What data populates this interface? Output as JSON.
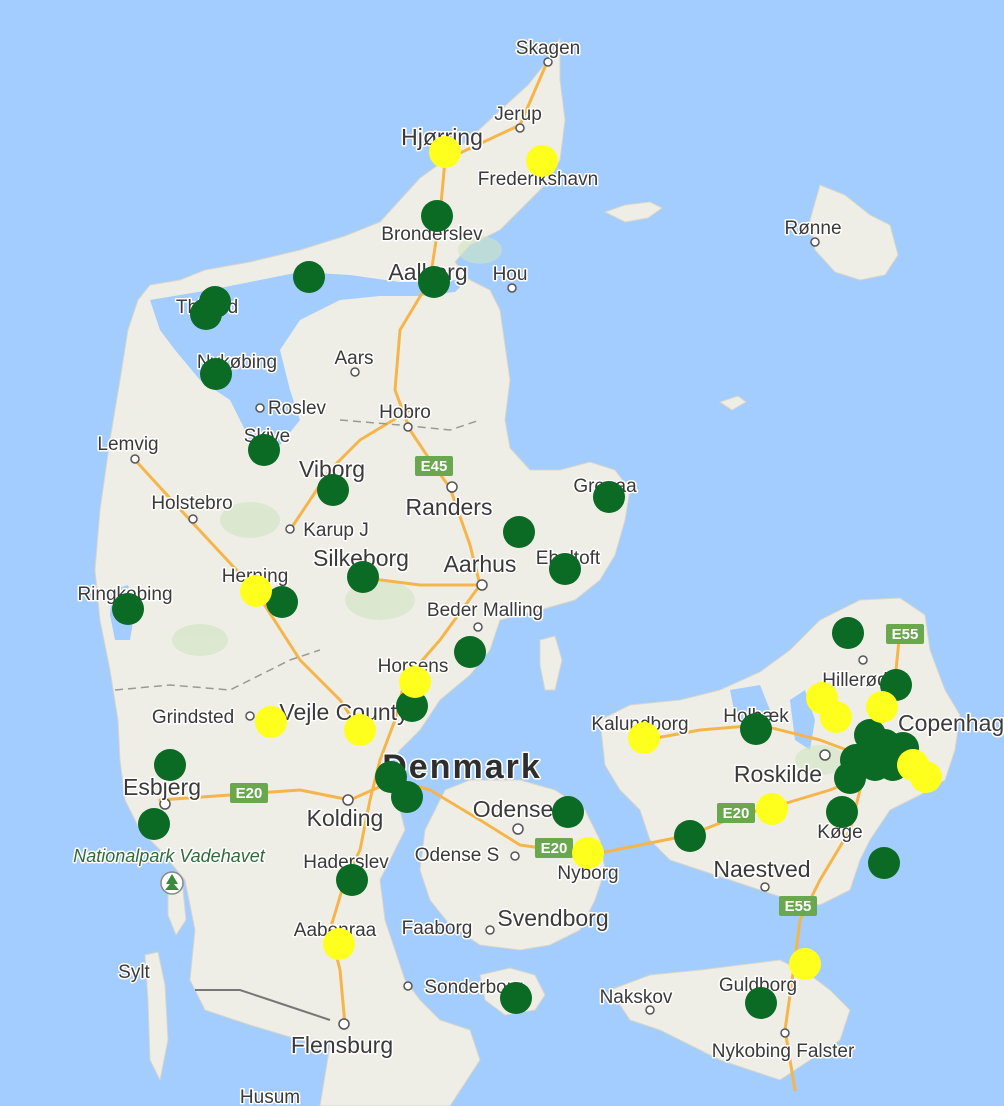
{
  "map": {
    "country_label": "Denmark",
    "park_label": "Nationalpark Vadehavet",
    "colors": {
      "water": "#a3ccff",
      "land": "#efeee6",
      "road": "#f5b54a",
      "motorway_shield": "#6aa84f",
      "marker_green": "#0b6a24",
      "marker_yellow": "#ffff1e"
    },
    "icons": [
      "park-icon"
    ],
    "place_labels": [
      "Skagen",
      "Jerup",
      "Hjørring",
      "Frederikshavn",
      "Rønne",
      "Bronderslev",
      "Aalborg",
      "Hou",
      "Thisted",
      "Nykøbing",
      "Aars",
      "Roslev",
      "Hobro",
      "Lemvig",
      "Skive",
      "Viborg",
      "Grenaa",
      "Holstebro",
      "Randers",
      "Karup J",
      "Silkeborg",
      "Ebeltoft",
      "Aarhus",
      "Ringkobing",
      "Herning",
      "Beder Malling",
      "Horsens",
      "Hillerød",
      "Copenhagen",
      "Grindsted",
      "Vejle County",
      "Kalundborg",
      "Holbæk",
      "Roskilde",
      "Esbjerg",
      "Odense",
      "Kolding",
      "Køge",
      "Haderslev",
      "Odense S",
      "Nyborg",
      "Naestved",
      "Svendborg",
      "Aabenraa",
      "Faaborg",
      "Sylt",
      "Sonderborg",
      "Nakskov",
      "Guldborg",
      "Flensburg",
      "Nykobing Falster",
      "Husum"
    ],
    "road_shields": [
      "E45",
      "E20",
      "E20",
      "E20",
      "E55",
      "E55"
    ]
  }
}
